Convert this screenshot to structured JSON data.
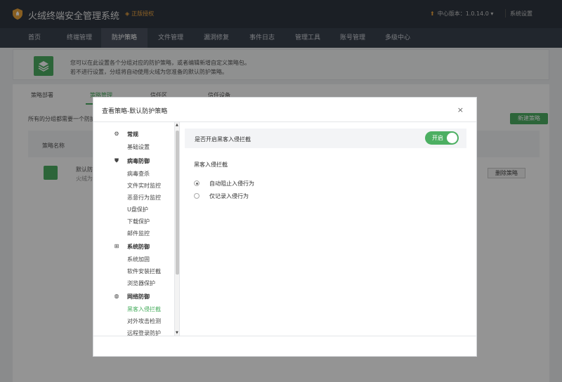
{
  "header": {
    "app_title": "火绒终端安全管理系统",
    "license_label": "正版授权",
    "version_label": "中心版本：1.0.14.0",
    "settings_label": "系统设置"
  },
  "nav": [
    "首页",
    "终端管理",
    "防护策略",
    "文件管理",
    "漏洞修复",
    "事件日志",
    "管理工具",
    "账号管理",
    "多级中心"
  ],
  "page": {
    "info_line1": "您可以在此设置各个分组对应的防护策略，或者编辑新增自定义策略包。",
    "info_line2": "若不进行设置，分组将自动使用火绒为您准备的默认防护策略。",
    "tabs": [
      "策略部署",
      "策略管理",
      "信任区",
      "信任设备"
    ],
    "description": "所有的分组都需要一个防护",
    "new_policy_button": "新建策略",
    "table_header": "策略名称",
    "row_title": "默认防",
    "row_subtitle": "火绒为",
    "delete_button": "删除策略"
  },
  "modal": {
    "title": "查看策略-默认防护策略",
    "close_label": "×",
    "menu": {
      "general": {
        "label": "常规",
        "items": [
          "基础设置"
        ]
      },
      "virus": {
        "label": "病毒防御",
        "items": [
          "病毒查杀",
          "文件实时监控",
          "恶意行为监控",
          "U盘保护",
          "下载保护",
          "邮件监控"
        ]
      },
      "system": {
        "label": "系统防御",
        "items": [
          "系统加固",
          "软件安装拦截",
          "浏览器保护"
        ]
      },
      "network": {
        "label": "网络防御",
        "items": [
          "黑客入侵拦截",
          "对外攻击检测",
          "远程登录防护"
        ]
      }
    },
    "content": {
      "switch_label": "是否开启黑客入侵拦截",
      "toggle_label": "开启",
      "toggle_on": true,
      "section_label": "黑客入侵拦截",
      "options": [
        "自动阻止入侵行为",
        "仅记录入侵行为"
      ],
      "selected_option": 0
    }
  },
  "colors": {
    "accent": "#4caf62",
    "header_bg": "#2f3641",
    "nav_bg": "#3a424f"
  }
}
